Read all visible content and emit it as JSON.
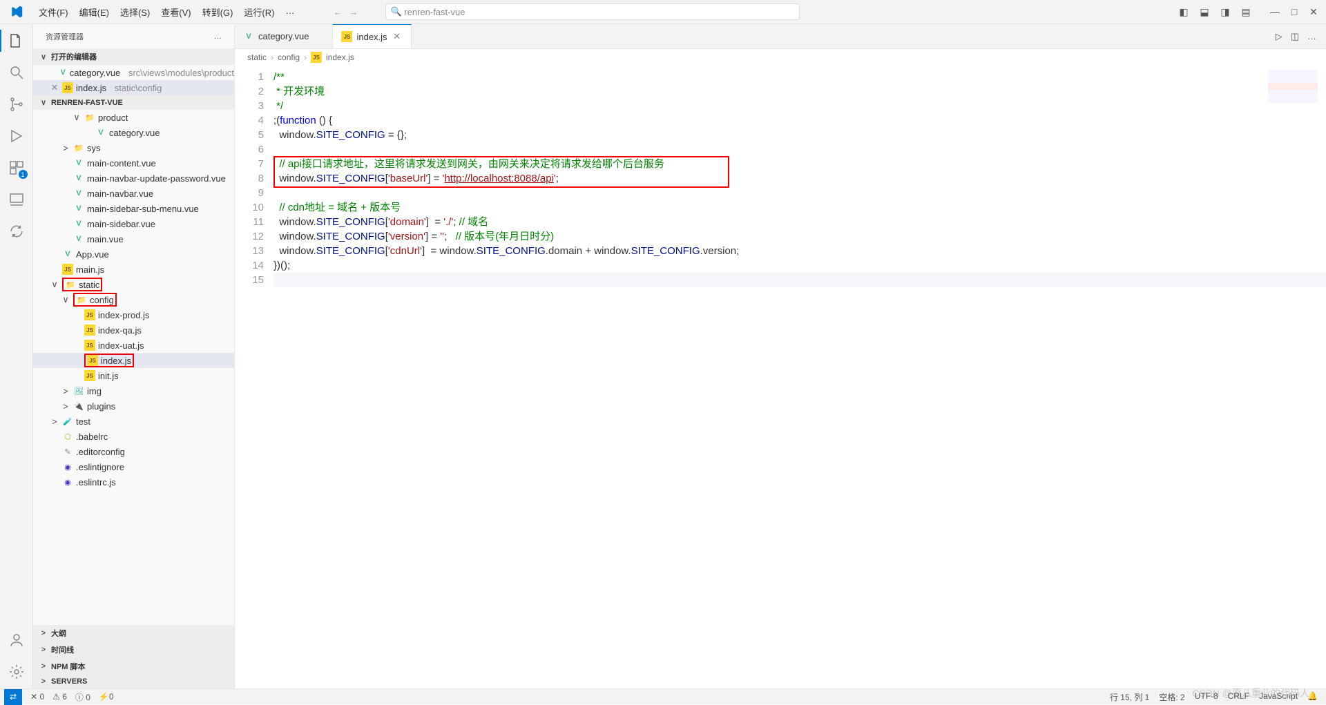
{
  "menu": {
    "file": "文件(F)",
    "edit": "编辑(E)",
    "select": "选择(S)",
    "view": "查看(V)",
    "goto": "转到(G)",
    "run": "运行(R)",
    "more": "…"
  },
  "search": {
    "placeholder": "renren-fast-vue",
    "icon": "🔍"
  },
  "win": {
    "min": "—",
    "max": "□",
    "close": "✕"
  },
  "sidebar": {
    "title": "资源管理器",
    "more": "…"
  },
  "openEditors": {
    "label": "打开的编辑器",
    "items": [
      {
        "icon": "V",
        "name": "category.vue",
        "path": "src\\views\\modules\\product"
      },
      {
        "pre": "✕",
        "icon": "JS",
        "name": "index.js",
        "path": "static\\config"
      }
    ]
  },
  "root": "RENREN-FAST-VUE",
  "tree": [
    {
      "indent": 3,
      "chev": "∨",
      "icon": "📁",
      "iconCls": "ic-fold",
      "name": "product"
    },
    {
      "indent": 4,
      "icon": "V",
      "iconCls": "ic-vue",
      "name": "category.vue"
    },
    {
      "indent": 2,
      "chev": ">",
      "icon": "📁",
      "iconCls": "ic-fold",
      "name": "sys"
    },
    {
      "indent": 2,
      "icon": "V",
      "iconCls": "ic-vue",
      "name": "main-content.vue"
    },
    {
      "indent": 2,
      "icon": "V",
      "iconCls": "ic-vue",
      "name": "main-navbar-update-password.vue"
    },
    {
      "indent": 2,
      "icon": "V",
      "iconCls": "ic-vue",
      "name": "main-navbar.vue"
    },
    {
      "indent": 2,
      "icon": "V",
      "iconCls": "ic-vue",
      "name": "main-sidebar-sub-menu.vue"
    },
    {
      "indent": 2,
      "icon": "V",
      "iconCls": "ic-vue",
      "name": "main-sidebar.vue"
    },
    {
      "indent": 2,
      "icon": "V",
      "iconCls": "ic-vue",
      "name": "main.vue"
    },
    {
      "indent": 1,
      "icon": "V",
      "iconCls": "ic-vue",
      "name": "App.vue"
    },
    {
      "indent": 1,
      "icon": "JS",
      "iconCls": "ic-js",
      "name": "main.js"
    },
    {
      "indent": 1,
      "chev": "∨",
      "icon": "📁",
      "iconCls": "ic-fold",
      "name": "static",
      "box": true
    },
    {
      "indent": 2,
      "chev": "∨",
      "icon": "📁",
      "iconCls": "ic-fold-b",
      "name": "config",
      "box": true
    },
    {
      "indent": 3,
      "icon": "JS",
      "iconCls": "ic-js",
      "name": "index-prod.js"
    },
    {
      "indent": 3,
      "icon": "JS",
      "iconCls": "ic-js",
      "name": "index-qa.js"
    },
    {
      "indent": 3,
      "icon": "JS",
      "iconCls": "ic-js",
      "name": "index-uat.js"
    },
    {
      "indent": 3,
      "icon": "JS",
      "iconCls": "ic-js",
      "name": "index.js",
      "sel": true,
      "box": true
    },
    {
      "indent": 3,
      "icon": "JS",
      "iconCls": "ic-js",
      "name": "init.js"
    },
    {
      "indent": 2,
      "chev": ">",
      "icon": "🖼",
      "iconCls": "ic-img",
      "name": "img"
    },
    {
      "indent": 2,
      "chev": ">",
      "icon": "🔌",
      "iconCls": "ic-plug",
      "name": "plugins"
    },
    {
      "indent": 1,
      "chev": ">",
      "icon": "🧪",
      "iconCls": "ic-test",
      "name": "test"
    },
    {
      "indent": 1,
      "icon": "⬡",
      "iconCls": "ic-babel",
      "name": ".babelrc"
    },
    {
      "indent": 1,
      "icon": "✎",
      "iconCls": "ic-edit",
      "name": ".editorconfig"
    },
    {
      "indent": 1,
      "icon": "◉",
      "iconCls": "ic-eslint",
      "name": ".eslintignore"
    },
    {
      "indent": 1,
      "icon": "◉",
      "iconCls": "ic-eslint",
      "name": ".eslintrc.js"
    }
  ],
  "sections": [
    {
      "name": "大纲"
    },
    {
      "name": "时间线"
    },
    {
      "name": "NPM 脚本"
    },
    {
      "name": "SERVERS"
    }
  ],
  "tabs": [
    {
      "icon": "V",
      "iconCls": "ic-vue",
      "name": "category.vue",
      "close": ""
    },
    {
      "icon": "JS",
      "iconCls": "ic-js",
      "name": "index.js",
      "close": "✕",
      "active": true
    }
  ],
  "crumbs": [
    "static",
    "config",
    "index.js"
  ],
  "crumbIcon": "JS",
  "code": {
    "lines": [
      "1",
      "2",
      "3",
      "4",
      "5",
      "6",
      "7",
      "8",
      "9",
      "10",
      "11",
      "12",
      "13",
      "14",
      "15"
    ],
    "r1": "/**",
    "r2": " * 开发环境",
    "r3": " */",
    "r4_a": ";(",
    "r4_b": "function",
    "r4_c": " () {",
    "r5_a": "  window.",
    "r5_b": "SITE_CONFIG",
    "r5_c": " = {};",
    "r7": "  // api接口请求地址，这里将请求发送到网关，由网关来决定将请求发给哪个后台服务",
    "r8_a": "  window.",
    "r8_b": "SITE_CONFIG",
    "r8_c": "[",
    "r8_d": "'baseUrl'",
    "r8_e": "] = ",
    "r8_f": "'",
    "r8_g": "http://localhost:8088/api",
    "r8_h": "'",
    ";": ";",
    "r10": "  // cdn地址 = 域名 + 版本号",
    "r11_a": "  window.",
    "r11_b": "SITE_CONFIG",
    "r11_c": "[",
    "r11_d": "'domain'",
    "r11_e": "]  = ",
    "r11_f": "'./'",
    "r11_g": "; ",
    "r11_h": "// 域名",
    "r12_a": "  window.",
    "r12_b": "SITE_CONFIG",
    "r12_c": "[",
    "r12_d": "'version'",
    "r12_e": "] = ",
    "r12_f": "''",
    "r12_g": ";   ",
    "r12_h": "// 版本号(年月日时分)",
    "r13_a": "  window.",
    "r13_b": "SITE_CONFIG",
    "r13_c": "[",
    "r13_d": "'cdnUrl'",
    "r13_e": "]  = window.",
    "r13_f": "SITE_CONFIG",
    "r13_g": ".domain + window.",
    "r13_h": "SITE_CONFIG",
    "r13_i": ".version;",
    "r14": "})();"
  },
  "status": {
    "errors": "✕ 0",
    "warnings": "⚠ 6",
    "info": "ⓘ 0",
    "port": "⚡0",
    "pos": "行 15, 列 1",
    "spaces": "空格: 2",
    "enc": "UTF-8",
    "eol": "CRLF",
    "lang": "JavaScript",
    "bell": "🔔"
  },
  "watermark": "CSDN @愿八重业的代码人",
  "badge1": "1"
}
